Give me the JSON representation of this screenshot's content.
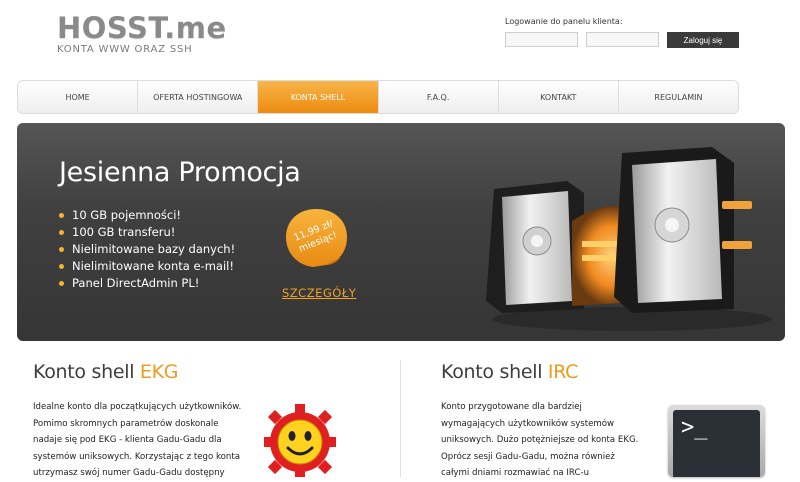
{
  "header": {
    "logo_main": "HOSST.me",
    "logo_sub": "KONTA WWW ORAZ SSH",
    "login_label": "Logowanie do panelu klienta:",
    "login_button": "Zaloguj się"
  },
  "nav": {
    "items": [
      {
        "label": "HOME"
      },
      {
        "label": "OFERTA HOSTINGOWA"
      },
      {
        "label": "KONTA SHELL"
      },
      {
        "label": "F.A.Q."
      },
      {
        "label": "KONTAKT"
      },
      {
        "label": "REGULAMIN"
      }
    ],
    "active": "KONTA SHELL"
  },
  "banner": {
    "title": "Jesienna Promocja",
    "features": [
      "10 GB pojemności!",
      "100 GB transferu!",
      "Nielimitowane bazy danych!",
      "Nielimitowane konta e-mail!",
      "Panel DirectAdmin PL!"
    ],
    "price_line1": "11,99 zł/",
    "price_line2": "miesiąc!",
    "details_link": "SZCZEGÓŁY"
  },
  "sections": {
    "ekg": {
      "title_prefix": "Konto shell ",
      "title_accent": "EKG",
      "lines": [
        "Idealne konto dla początkujących użytkowników.",
        "Pomimo skromnych parametrów doskonale",
        "nadaje się pod EKG - klienta Gadu-Gadu dla",
        "systemów uniksowych. Korzystając z tego konta",
        "utrzymasz swój numer Gadu-Gadu dostępny"
      ]
    },
    "irc": {
      "title_prefix": "Konto shell ",
      "title_accent": "IRC",
      "lines": [
        "Konto przygotowane dla bardziej",
        "wymagających użytkowników systemów",
        "uniksowych. Dużo potężniejsze od konta EKG.",
        "Oprócz sesji Gadu-Gadu, można również",
        "całymi dniami rozmawiać na IRC-u"
      ],
      "terminal_prompt": ">_"
    }
  },
  "colors": {
    "accent_orange": "#f09a1e",
    "nav_active": "#ee8b10",
    "banner_bg": "#404040",
    "bullet": "#f6b527"
  }
}
